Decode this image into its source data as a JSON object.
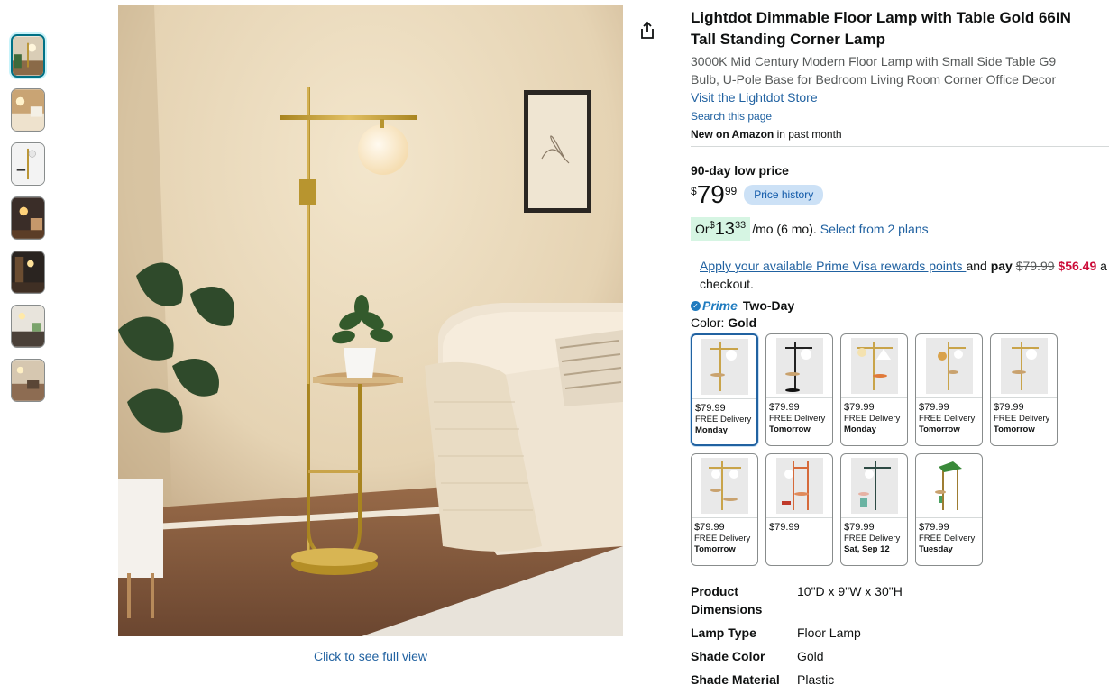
{
  "thumbnails": [
    "thumb-1",
    "thumb-2",
    "thumb-3",
    "thumb-4",
    "thumb-5",
    "thumb-6",
    "thumb-7"
  ],
  "main_image": {
    "full_view_link": "Click to see full view"
  },
  "product": {
    "title": "Lightdot Dimmable Floor Lamp with Table Gold 66IN Tall Standing Corner Lamp",
    "subtitle": "3000K Mid Century Modern Floor Lamp with Small Side Table G9 Bulb, U-Pole Base for Bedroom Living Room Corner Office Decor",
    "store_link": "Visit the Lightdot Store",
    "search_page": "Search this page",
    "new_on_amazon_bold": "New on Amazon",
    "new_on_amazon_rest": " in past month"
  },
  "pricing": {
    "low_price_label": "90-day low price",
    "currency": "$",
    "whole": "79",
    "fraction": "99",
    "price_history_button": "Price history",
    "installment_prefix": "Or ",
    "installment_currency": "$",
    "installment_whole": "13",
    "installment_fraction": "33",
    "installment_suffix": "/mo (6 mo).",
    "installment_plans_link": "Select from 2 plans"
  },
  "rewards": {
    "link_text": "Apply your available Prime Visa rewards points ",
    "mid_text": "and ",
    "pay_text": "pay",
    "old_price": "$79.99",
    "new_price": "$56.49",
    "trail": " a",
    "line2": "checkout."
  },
  "delivery": {
    "prime_label": "Prime",
    "speed": "Two-Day"
  },
  "color": {
    "label": "Color: ",
    "value": "Gold"
  },
  "swatches": [
    {
      "price": "$79.99",
      "delivery": "FREE Delivery",
      "day": "Monday"
    },
    {
      "price": "$79.99",
      "delivery": "FREE Delivery",
      "day": "Tomorrow"
    },
    {
      "price": "$79.99",
      "delivery": "FREE Delivery",
      "day": "Monday"
    },
    {
      "price": "$79.99",
      "delivery": "FREE Delivery",
      "day": "Tomorrow"
    },
    {
      "price": "$79.99",
      "delivery": "FREE Delivery",
      "day": "Tomorrow"
    },
    {
      "price": "$79.99",
      "delivery": "FREE Delivery",
      "day": "Tomorrow"
    },
    {
      "price": "$79.99",
      "delivery": "",
      "day": ""
    },
    {
      "price": "$79.99",
      "delivery": "FREE Delivery",
      "day": "Sat, Sep 12"
    },
    {
      "price": "$79.99",
      "delivery": "FREE Delivery",
      "day": "Tuesday"
    }
  ],
  "specs": [
    {
      "key": "Product Dimensions",
      "value": "10\"D x 9\"W x 30\"H"
    },
    {
      "key": "Lamp Type",
      "value": "Floor Lamp"
    },
    {
      "key": "Shade Color",
      "value": "Gold"
    },
    {
      "key": "Shade Material",
      "value": "Plastic"
    }
  ],
  "colors": {
    "link": "#2162a1",
    "accent_selected": "#2162a1",
    "deal_red": "#cc0c39",
    "prime_blue": "#1f7bbf",
    "installment_bg": "#d6f5e3",
    "price_history_bg": "#cce1f6"
  }
}
